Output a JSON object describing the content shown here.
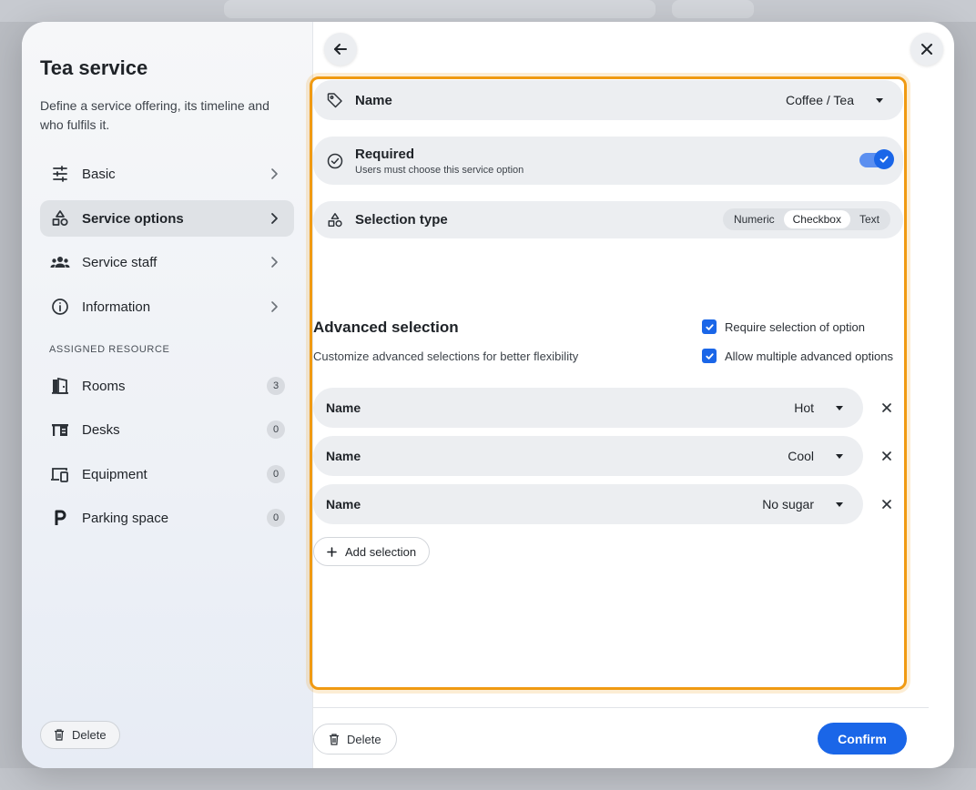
{
  "sidebar": {
    "title": "Tea service",
    "description": "Define a service offering, its timeline and who fulfils it.",
    "nav": [
      {
        "label": "Basic"
      },
      {
        "label": "Service options"
      },
      {
        "label": "Service staff"
      },
      {
        "label": "Information"
      }
    ],
    "section_label": "ASSIGNED RESOURCE",
    "resources": [
      {
        "label": "Rooms",
        "count": "3"
      },
      {
        "label": "Desks",
        "count": "0"
      },
      {
        "label": "Equipment",
        "count": "0"
      },
      {
        "label": "Parking space",
        "count": "0"
      }
    ],
    "delete_label": "Delete"
  },
  "form": {
    "name_label": "Name",
    "name_value": "Coffee / Tea",
    "required_label": "Required",
    "required_sub": "Users must choose this service option",
    "required_on": true,
    "selection_type_label": "Selection type",
    "selection_types": [
      "Numeric",
      "Checkbox",
      "Text"
    ],
    "selection_type_selected": "Checkbox"
  },
  "advanced": {
    "title": "Advanced selection",
    "description": "Customize advanced selections for better flexibility",
    "require_label": "Require selection of option",
    "require_checked": true,
    "multiple_label": "Allow multiple advanced options",
    "multiple_checked": true,
    "selections": [
      {
        "label": "Name",
        "value": "Hot"
      },
      {
        "label": "Name",
        "value": "Cool"
      },
      {
        "label": "Name",
        "value": "No sugar"
      }
    ],
    "add_label": "Add selection"
  },
  "footer": {
    "delete_label": "Delete",
    "confirm_label": "Confirm"
  },
  "colors": {
    "accent": "#1a66e8",
    "focus": "#f09a12"
  }
}
